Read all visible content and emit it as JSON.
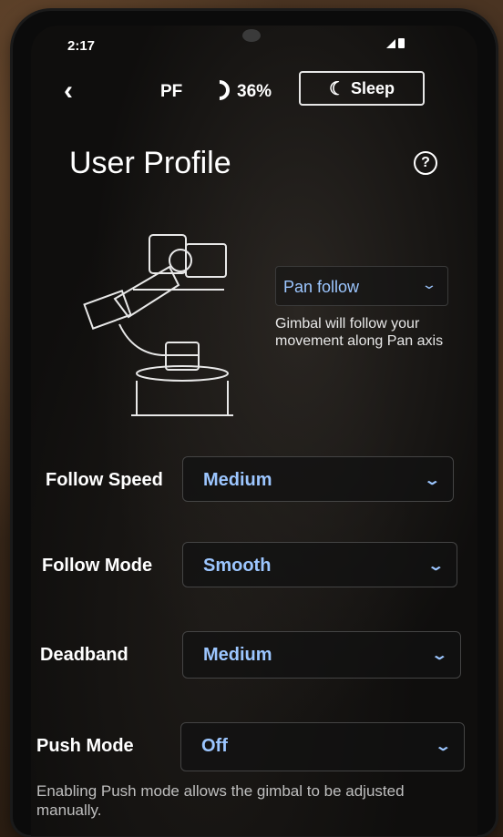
{
  "status_bar": {
    "time": "2:17"
  },
  "header": {
    "profile_abbr": "PF",
    "battery_percent": "36%",
    "sleep_label": "Sleep"
  },
  "page": {
    "title": "User Profile",
    "help_glyph": "?"
  },
  "axis_mode": {
    "selected": "Pan follow",
    "description": "Gimbal will follow your movement along Pan axis"
  },
  "settings": [
    {
      "label": "Follow Speed",
      "value": "Medium"
    },
    {
      "label": "Follow Mode",
      "value": "Smooth"
    },
    {
      "label": "Deadband",
      "value": "Medium"
    },
    {
      "label": "Push Mode",
      "value": "Off"
    }
  ],
  "push_mode_helper": "Enabling Push mode allows the gimbal to be adjusted manually.",
  "icons": [
    "back-chevron-icon",
    "battery-ring-icon",
    "moon-icon",
    "help-icon",
    "chevron-down-icon",
    "gimbal-illustration"
  ],
  "colors": {
    "accent": "#9cc6ff",
    "background": "#0f0e0d",
    "text": "#ffffff"
  }
}
